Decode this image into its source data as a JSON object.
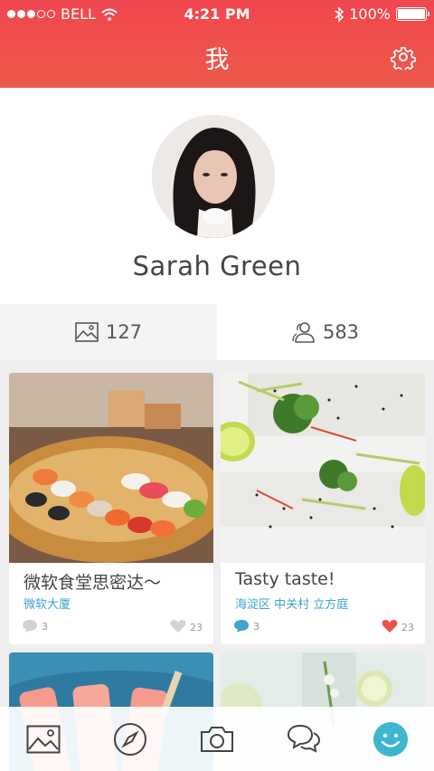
{
  "status_bar": {
    "carrier": "BELL",
    "time": "4:21 PM",
    "battery": "100%"
  },
  "header": {
    "title": "我"
  },
  "profile": {
    "name": "Sarah Green"
  },
  "stats": {
    "photos": "127",
    "followers": "583"
  },
  "posts": [
    {
      "title": "微软食堂思密达～",
      "location": "微软大厦",
      "comments": "3",
      "likes": "23"
    },
    {
      "title": "Tasty taste!",
      "location": "海淀区 中关村 立方庭",
      "comments": "3",
      "likes": "23"
    }
  ],
  "colors": {
    "accent": "#f0464e",
    "link": "#3da4cb",
    "like_active": "#f05046"
  },
  "tabs": [
    "photos-icon",
    "compass-icon",
    "camera-icon",
    "chat-icon",
    "profile-smile-icon"
  ]
}
